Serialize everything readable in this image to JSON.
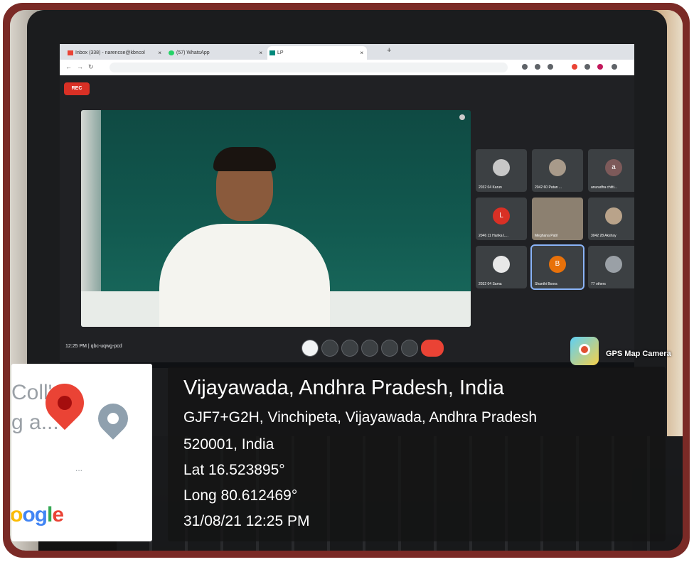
{
  "browser": {
    "tabs": [
      {
        "label": "Inbox (338) - narencse@kbncol",
        "icon": "gmail-icon"
      },
      {
        "label": "(57) WhatsApp",
        "icon": "whatsapp-icon"
      },
      {
        "label": "LP",
        "icon": "meet-icon"
      }
    ],
    "new_tab": "+"
  },
  "meet": {
    "rec_label": "REC",
    "time_code": "12:25 PM  |  qbc-uqwg-pcd",
    "participants": [
      {
        "name": "2032 04 Karun",
        "initial": ""
      },
      {
        "name": "2042 60 Patan ...",
        "initial": ""
      },
      {
        "name": "anuradha chitti...",
        "initial": "a"
      },
      {
        "name": "2046 11 Harika L...",
        "initial": "L"
      },
      {
        "name": "Meghana Patil",
        "initial": ""
      },
      {
        "name": "3042 28 Akshay",
        "initial": ""
      },
      {
        "name": "2032 04 Sama",
        "initial": ""
      },
      {
        "name": "Shanthi Boora",
        "initial": "B"
      },
      {
        "name": "77 others",
        "initial": ""
      }
    ]
  },
  "gps_app": {
    "label": "GPS Map Camera"
  },
  "map": {
    "text_line1": "Coll'e",
    "text_line2": "g a...",
    "dots": "...",
    "brand": "oogle"
  },
  "location": {
    "title": "Vijayawada, Andhra Pradesh, India",
    "address_line1": "GJF7+G2H, Vinchipeta, Vijayawada, Andhra Pradesh",
    "address_line2": "520001, India",
    "lat": "Lat 16.523895°",
    "long": "Long 80.612469°",
    "datetime": "31/08/21 12:25 PM"
  },
  "colors": {
    "frame": "#7a2a26",
    "meet_bg": "#202124",
    "rec": "#d93025",
    "pin_red": "#ea4335",
    "pin_gray": "#8fa0ae"
  }
}
